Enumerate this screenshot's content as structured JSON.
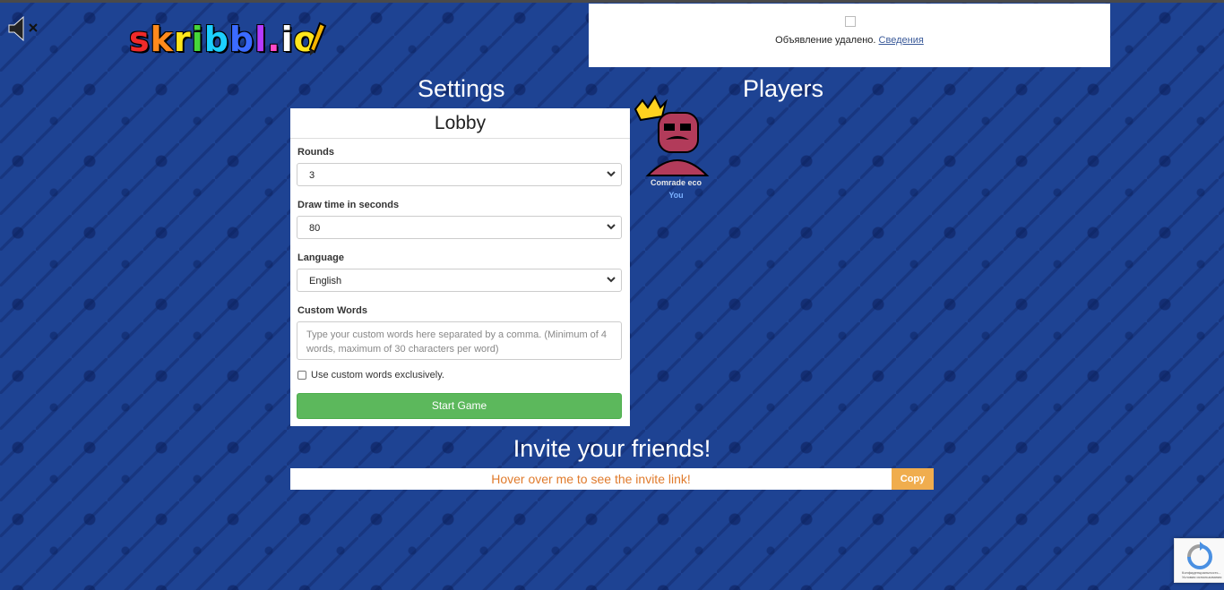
{
  "logo": [
    "s",
    "k",
    "r",
    "i",
    "b",
    "b",
    "l",
    ".",
    "i",
    "o",
    "!"
  ],
  "ad": {
    "text": "Объявление удалено.",
    "link": "Сведения"
  },
  "headings": {
    "settings": "Settings",
    "players": "Players"
  },
  "lobby": {
    "title": "Lobby",
    "rounds_label": "Rounds",
    "rounds_value": "3",
    "drawtime_label": "Draw time in seconds",
    "drawtime_value": "80",
    "language_label": "Language",
    "language_value": "English",
    "custom_words_label": "Custom Words",
    "custom_words_placeholder": "Type your custom words here separated by a comma. (Minimum of 4 words, maximum of 30 characters per word)",
    "exclusive_label": "Use custom words exclusively.",
    "exclusive_checked": false,
    "start_button": "Start Game"
  },
  "players": [
    {
      "name": "Comrade eco",
      "tag": "You",
      "is_owner": true
    }
  ],
  "invite": {
    "heading": "Invite your friends!",
    "link_text": "Hover over me to see the invite link!",
    "copy_button": "Copy"
  },
  "recaptcha": {
    "text": "Конфиденциальность - Условия использования"
  },
  "colors": {
    "background": "#1e4393",
    "start_button": "#5cb85c",
    "copy_button": "#f0ad4e",
    "invite_text": "#e07b2c",
    "you_label": "#7ab0ff"
  }
}
